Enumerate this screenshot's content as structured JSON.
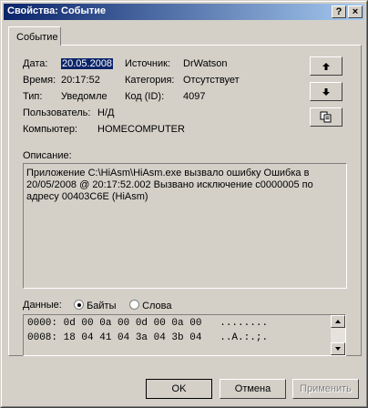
{
  "window": {
    "title": "Свойства: Событие"
  },
  "titlebar_buttons": {
    "help": "?",
    "close": "×"
  },
  "tab": {
    "label": "Событие"
  },
  "fields": {
    "date_label": "Дата:",
    "date_value": "20.05.2008",
    "source_label": "Источник:",
    "source_value": "DrWatson",
    "time_label": "Время:",
    "time_value": "20:17:52",
    "category_label": "Категория:",
    "category_value": "Отсутствует",
    "type_label": "Тип:",
    "type_value": "Уведомле",
    "code_label": "Код (ID):",
    "code_value": "4097",
    "user_label": "Пользователь:",
    "user_value": "Н/Д",
    "computer_label": "Компьютер:",
    "computer_value": "HOMECOMPUTER"
  },
  "description": {
    "label": "Описание:",
    "text": "Приложение C:\\HiAsm\\HiAsm.exe вызвало ошибку Ошибка в 20/05/2008 @ 20:17:52.002 Вызвано исключение c0000005 по адресу 00403C6E (HiAsm)"
  },
  "data_section": {
    "label": "Данные:",
    "bytes_label": "Байты",
    "words_label": "Слова",
    "selected": "bytes",
    "lines": [
      "0000: 0d 00 0a 00 0d 00 0a 00   ........",
      "0008: 18 04 41 04 3a 04 3b 04   ..A.:.;."
    ]
  },
  "side_buttons": [
    "up-arrow-icon",
    "down-arrow-icon",
    "copy-icon"
  ],
  "buttons": {
    "ok": "OK",
    "cancel": "Отмена",
    "apply": "Применить"
  },
  "colors": {
    "title_start": "#0a246a",
    "title_end": "#a6caf0",
    "face": "#d4d0c8",
    "selection": "#0a246a",
    "disabled": "#808080"
  }
}
